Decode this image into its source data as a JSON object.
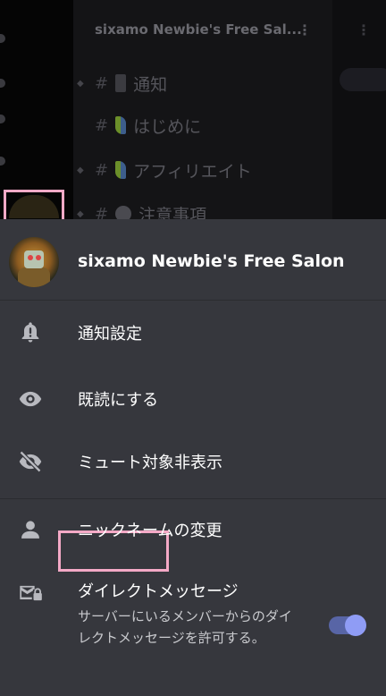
{
  "background": {
    "server_name": "sixamo Newbie's Free Sal...",
    "kebab": "⋮",
    "channels": [
      {
        "hash": "#",
        "name": "通知"
      },
      {
        "hash": "#",
        "name": "はじめに"
      },
      {
        "hash": "#",
        "name": "アフィリエイト"
      },
      {
        "hash": "#",
        "name": "注意事項"
      }
    ]
  },
  "sheet": {
    "server_title": "sixamo Newbie's Free Salon",
    "items": [
      {
        "label": "通知設定",
        "icon": "bell-icon"
      },
      {
        "label": "既読にする",
        "icon": "eye-icon"
      },
      {
        "label": "ミュート対象非表示",
        "icon": "eye-off-icon"
      },
      {
        "label": "ニックネームの変更",
        "icon": "person-icon"
      },
      {
        "label": "ダイレクトメッセージ",
        "icon": "mail-lock-icon",
        "description": "サーバーにいるメンバーからのダイレクトメッセージを許可する。",
        "toggle_on": true
      }
    ]
  },
  "colors": {
    "sheet_bg": "#36373d",
    "highlight": "#f4a9c6",
    "toggle_accent": "#8f9cf5"
  }
}
